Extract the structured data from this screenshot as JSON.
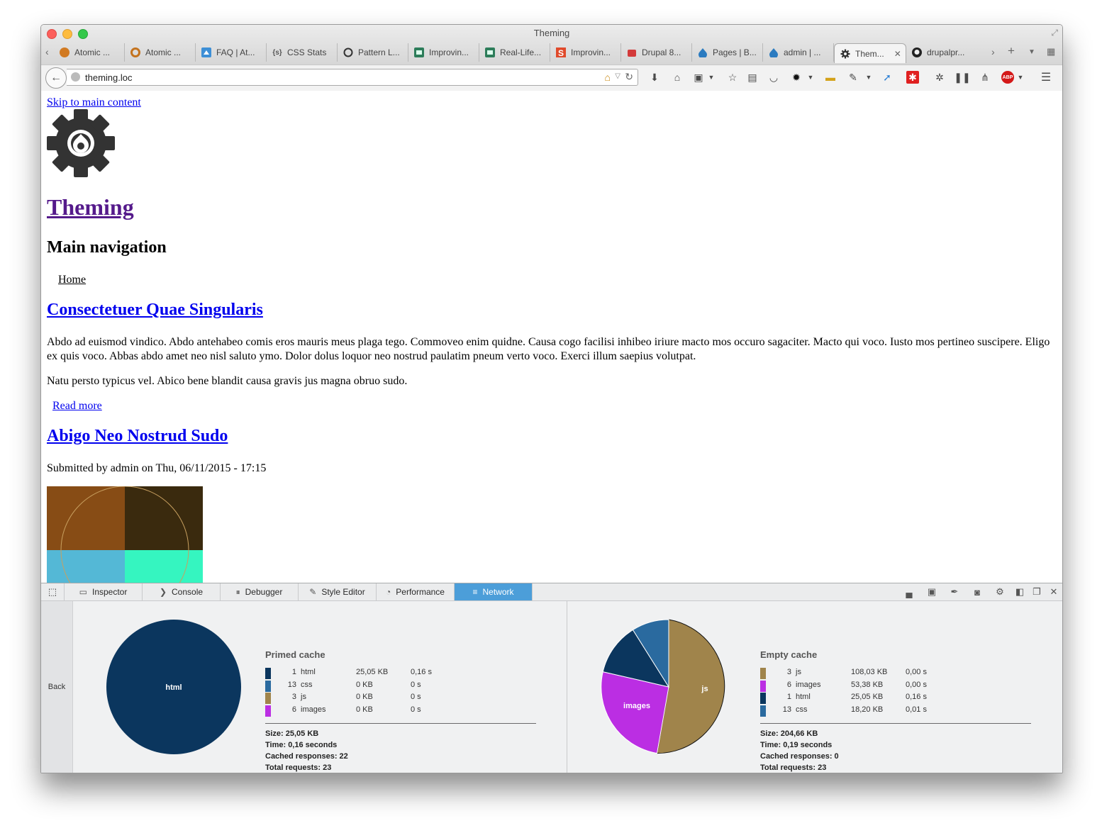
{
  "window": {
    "title": "Theming"
  },
  "tabs": [
    {
      "label": "Atomic ...",
      "icon": "orange-circle-icon"
    },
    {
      "label": "Atomic ...",
      "icon": "orange-ring-icon"
    },
    {
      "label": "FAQ | At...",
      "icon": "blue-house-icon"
    },
    {
      "label": "CSS Stats",
      "icon": "braces-icon"
    },
    {
      "label": "Pattern L...",
      "icon": "circle-outline-icon"
    },
    {
      "label": "Improvin...",
      "icon": "green-box-icon"
    },
    {
      "label": "Real-Life...",
      "icon": "green-box-icon"
    },
    {
      "label": "Improvin...",
      "icon": "red-s-icon"
    },
    {
      "label": "Drupal 8...",
      "icon": "red-robot-icon"
    },
    {
      "label": "Pages | B...",
      "icon": "drupal-drop-icon"
    },
    {
      "label": "admin | ...",
      "icon": "drupal-drop-icon"
    },
    {
      "label": "Them...",
      "icon": "gear-icon",
      "active": true
    },
    {
      "label": "drupalpr...",
      "icon": "github-icon"
    }
  ],
  "navbar": {
    "url": "theming.loc"
  },
  "page": {
    "skip_link": "Skip to main content",
    "site_name": "Theming",
    "main_nav_heading": "Main navigation",
    "home_link": "Home",
    "article1": {
      "title": "Consectetuer Quae Singularis",
      "p1": "Abdo ad euismod vindico. Abdo antehabeo comis eros mauris meus plaga tego. Commoveo enim quidne. Causa cogo facilisi inhibeo iriure macto mos occuro sagaciter. Macto qui voco. Iusto mos pertineo suscipere. Eligo ex quis voco. Abbas abdo amet neo nisl saluto ymo. Dolor dolus loquor neo nostrud paulatim pneum verto voco. Exerci illum saepius volutpat.",
      "p2": "Natu persto typicus vel. Abico bene blandit causa gravis jus magna obruo sudo.",
      "read_more": "Read more"
    },
    "article2": {
      "title": "Abigo Neo Nostrud Sudo",
      "submitted": "Submitted by admin on Thu, 06/11/2015 - 17:15"
    }
  },
  "devtools": {
    "tabs": [
      {
        "label": "Inspector",
        "icon": "inspector-icon"
      },
      {
        "label": "Console",
        "icon": "console-icon"
      },
      {
        "label": "Debugger",
        "icon": "debugger-icon"
      },
      {
        "label": "Style Editor",
        "icon": "style-editor-icon"
      },
      {
        "label": "Performance",
        "icon": "performance-icon"
      },
      {
        "label": "Network",
        "icon": "network-icon",
        "active": true
      }
    ],
    "back_label": "Back",
    "primed": {
      "title": "Primed cache",
      "rows": [
        {
          "count": "1",
          "type": "html",
          "size": "25,05 KB",
          "time": "0,16 s",
          "color": "#0b365e"
        },
        {
          "count": "13",
          "type": "css",
          "size": "0 KB",
          "time": "0 s",
          "color": "#2a6a9f"
        },
        {
          "count": "3",
          "type": "js",
          "size": "0 KB",
          "time": "0 s",
          "color": "#a0844b"
        },
        {
          "count": "6",
          "type": "images",
          "size": "0 KB",
          "time": "0 s",
          "color": "#bb2ee3"
        }
      ],
      "size": "Size: 25,05 KB",
      "time": "Time: 0,16 seconds",
      "cached": "Cached responses: 22",
      "total": "Total requests: 23",
      "pie_label": "html"
    },
    "empty": {
      "title": "Empty cache",
      "rows": [
        {
          "count": "3",
          "type": "js",
          "size": "108,03 KB",
          "time": "0,00 s",
          "color": "#a0844b"
        },
        {
          "count": "6",
          "type": "images",
          "size": "53,38 KB",
          "time": "0,00 s",
          "color": "#bb2ee3"
        },
        {
          "count": "1",
          "type": "html",
          "size": "25,05 KB",
          "time": "0,16 s",
          "color": "#0b365e"
        },
        {
          "count": "13",
          "type": "css",
          "size": "18,20 KB",
          "time": "0,01 s",
          "color": "#2a6a9f"
        }
      ],
      "size": "Size: 204,66 KB",
      "time": "Time: 0,19 seconds",
      "cached": "Cached responses: 0",
      "total": "Total requests: 23",
      "pie_labels": {
        "js": "js",
        "images": "images"
      }
    }
  }
}
